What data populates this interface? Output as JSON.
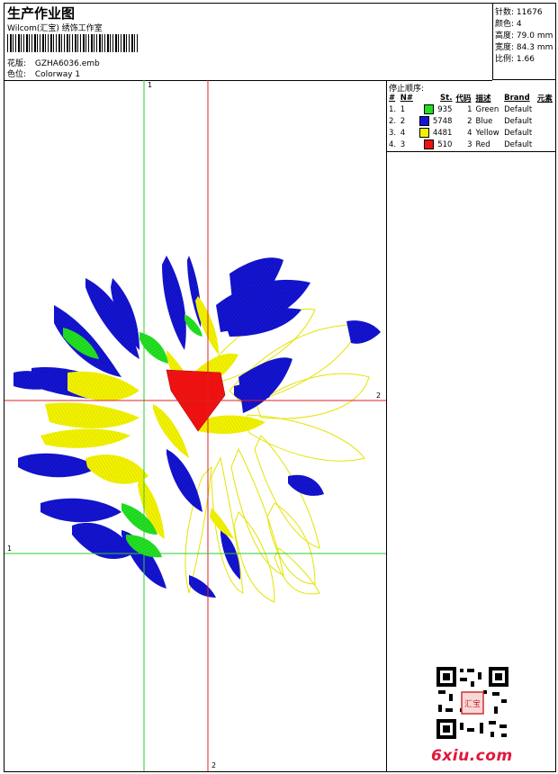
{
  "header": {
    "title": "生产作业图",
    "subtitle": "Wilcom(汇宝) 绣饰工作室",
    "design_label": "花版:",
    "design_value": "GZHA6036.emb",
    "colorway_label": "色位:",
    "colorway_value": "Colorway 1"
  },
  "specs": [
    {
      "label": "针数:",
      "value": "11676"
    },
    {
      "label": "颜色:",
      "value": "4"
    },
    {
      "label": "高度:",
      "value": "79.0 mm"
    },
    {
      "label": "宽度:",
      "value": "84.3 mm"
    },
    {
      "label": "比例:",
      "value": "1.66"
    }
  ],
  "stop_sequence": {
    "title": "停止顺序:",
    "headers": [
      "#",
      "N#",
      "St.",
      "代码",
      "描述",
      "Brand",
      "元素"
    ],
    "rows": [
      {
        "num": "1.",
        "n": "1",
        "color": "#22e022",
        "st": "935",
        "code": "1",
        "desc": "Green",
        "brand": "Default"
      },
      {
        "num": "2.",
        "n": "2",
        "color": "#1515d6",
        "st": "5748",
        "code": "2",
        "desc": "Blue",
        "brand": "Default"
      },
      {
        "num": "3.",
        "n": "4",
        "color": "#f2f200",
        "st": "4481",
        "code": "4",
        "desc": "Yellow",
        "brand": "Default"
      },
      {
        "num": "4.",
        "n": "3",
        "color": "#ee1111",
        "st": "510",
        "code": "3",
        "desc": "Red",
        "brand": "Default"
      }
    ]
  },
  "guides": {
    "v_green": "1",
    "v_red": "2",
    "h_green": "1",
    "h_red": "2"
  },
  "watermark": {
    "logo": "6xiu.com",
    "seal": "汇宝"
  },
  "colors": {
    "green": "#22e022",
    "blue": "#1515d6",
    "yellow": "#f2f200",
    "red": "#ee1111",
    "guide_green": "#2ecc2e",
    "guide_red": "#e02020"
  }
}
